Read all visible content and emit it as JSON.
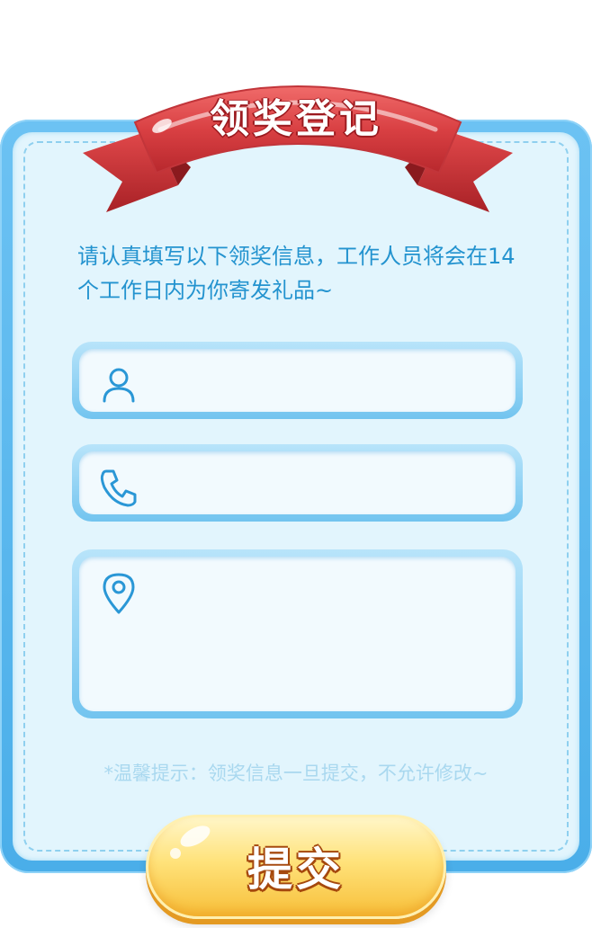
{
  "title": "领奖登记",
  "notice": "请认真填写以下领奖信息，工作人员将会在14个工作日内为你寄发礼品~",
  "fields": {
    "name": {
      "icon": "user-icon",
      "value": "",
      "placeholder": ""
    },
    "phone": {
      "icon": "phone-icon",
      "value": "",
      "placeholder": ""
    },
    "address": {
      "icon": "location-pin-icon",
      "value": "",
      "placeholder": ""
    }
  },
  "tip": "*温馨提示：领奖信息一旦提交，不允许修改~",
  "submit_label": "提交",
  "colors": {
    "frame_blue": "#4aaee9",
    "panel_bg": "#e2f5fd",
    "text_blue": "#2393cf",
    "ribbon_red": "#d94043",
    "button_yellow": "#ffe27a"
  }
}
